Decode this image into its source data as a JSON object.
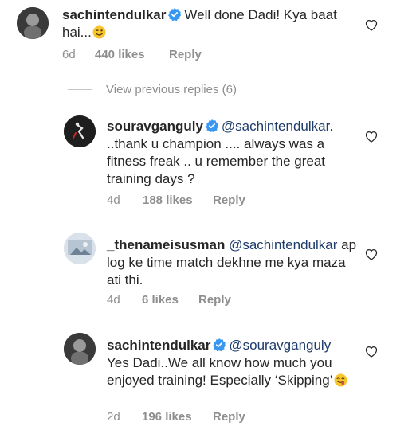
{
  "comments": [
    {
      "username": "sachintendulkar",
      "verified": true,
      "mention": "",
      "text": "Well done Dadi! Kya baat hai...",
      "emoji": "wink-emoji",
      "time": "6d",
      "likes": "440 likes",
      "reply": "Reply"
    },
    {
      "username": "souravganguly",
      "verified": true,
      "mention": "@sachintendulkar",
      "text": ". ..thank u champion .... always was a fitness freak .. u remember the great training days ?",
      "time": "4d",
      "likes": "188 likes",
      "reply": "Reply"
    },
    {
      "username": "_thenameisusman",
      "verified": false,
      "mention": "@sachintendulkar",
      "text": "ap log ke time match dekhne me kya maza ati thi.",
      "time": "4d",
      "likes": "6 likes",
      "reply": "Reply"
    },
    {
      "username": "sachintendulkar",
      "verified": true,
      "mention": "@souravganguly",
      "text": "Yes Dadi..We all know how much you enjoyed training! Especially ‘Skipping’",
      "emoji": "tongue-emoji",
      "time": "2d",
      "likes": "196 likes",
      "reply": "Reply"
    }
  ],
  "view_previous_replies": "View previous replies (6)",
  "colors": {
    "text": "#262626",
    "muted": "#8e8e8e",
    "verified": "#3897f0",
    "mention": "#1d3b6b"
  }
}
